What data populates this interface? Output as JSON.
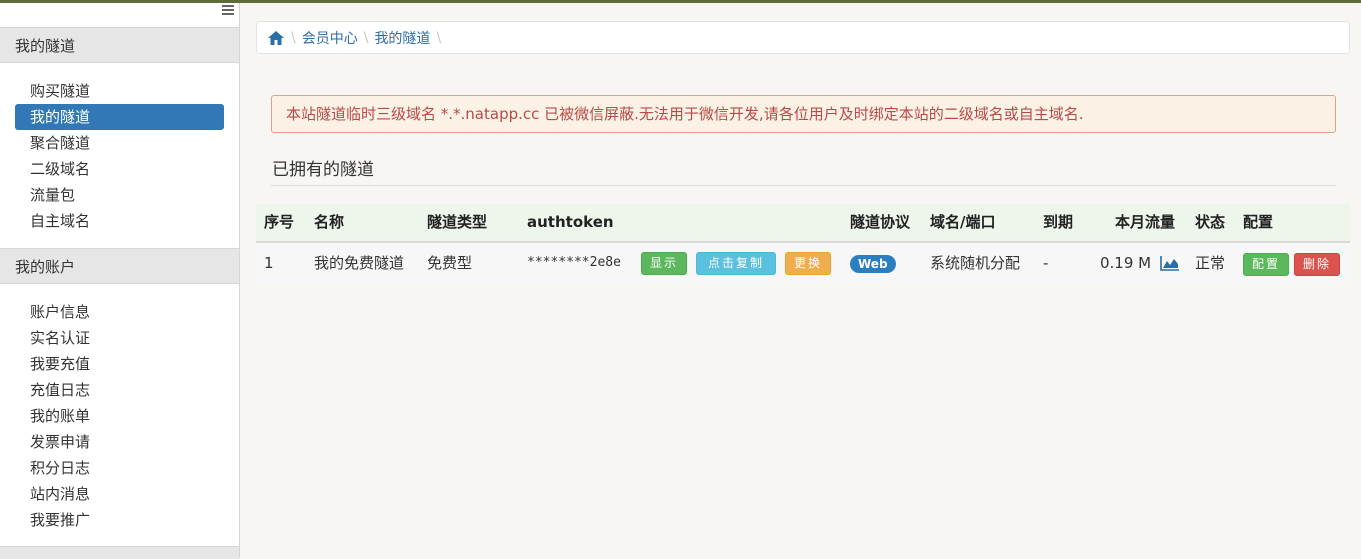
{
  "sidebar": {
    "sections": [
      {
        "title": "我的隧道",
        "items": [
          {
            "label": "购买隧道",
            "active": false
          },
          {
            "label": "我的隧道",
            "active": true
          },
          {
            "label": "聚合隧道",
            "active": false
          },
          {
            "label": "二级域名",
            "active": false
          },
          {
            "label": "流量包",
            "active": false
          },
          {
            "label": "自主域名",
            "active": false
          }
        ]
      },
      {
        "title": "我的账户",
        "items": [
          {
            "label": "账户信息"
          },
          {
            "label": "实名认证"
          },
          {
            "label": "我要充值"
          },
          {
            "label": "充值日志"
          },
          {
            "label": "我的账单"
          },
          {
            "label": "发票申请"
          },
          {
            "label": "积分日志"
          },
          {
            "label": "站内消息"
          },
          {
            "label": "我要推广"
          }
        ]
      }
    ]
  },
  "breadcrumb": {
    "items": [
      "会员中心",
      "我的隧道"
    ]
  },
  "alert": {
    "text": "本站隧道临时三级域名 *.*.natapp.cc 已被微信屏蔽.无法用于微信开发,请各位用户及时绑定本站的二级域名或自主域名."
  },
  "section_title": "已拥有的隧道",
  "table": {
    "headers": {
      "index": "序号",
      "name": "名称",
      "type": "隧道类型",
      "authtoken": "authtoken",
      "protocol": "隧道协议",
      "domain": "域名/端口",
      "expire": "到期",
      "traffic": "本月流量",
      "status": "状态",
      "config": "配置"
    },
    "rows": [
      {
        "index": "1",
        "name": "我的免费隧道",
        "type": "免费型",
        "authtoken": "********2e8e",
        "show_label": "显示",
        "copy_label": "点击复制",
        "change_label": "更换",
        "protocol": "Web",
        "domain": "系统随机分配",
        "expire": "-",
        "traffic": "0.19 M",
        "status": "正常",
        "config_label": "配置",
        "delete_label": "删除"
      }
    ]
  },
  "icons": {
    "home": "home-icon",
    "menu": "menu-icon",
    "traffic": "area-chart-icon"
  },
  "colors": {
    "accent": "#3278b6",
    "alert_text": "#b94a48",
    "header_bg": "#eef5ea"
  }
}
